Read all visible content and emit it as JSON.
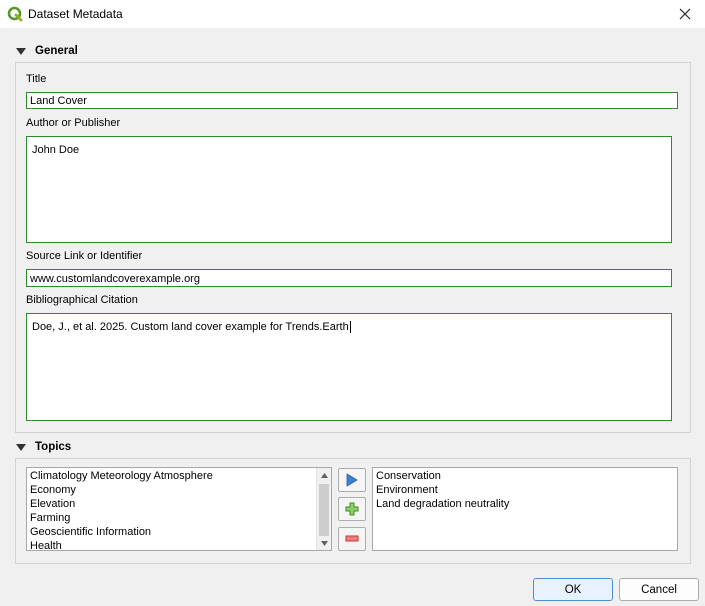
{
  "window": {
    "title": "Dataset Metadata",
    "icons": {
      "app": "qgis-logo-icon",
      "close": "close-icon"
    }
  },
  "general": {
    "header": "General",
    "title_label": "Title",
    "title_value": "Land Cover",
    "author_label": "Author or Publisher",
    "author_value": "John Doe",
    "source_label": "Source Link or Identifier",
    "source_value": "www.customlandcoverexample.org",
    "citation_label": "Bibliographical Citation",
    "citation_value": "Doe, J., et al. 2025. Custom land cover example for Trends.Earth"
  },
  "topics": {
    "header": "Topics",
    "available": [
      "Climatology Meteorology Atmosphere",
      "Economy",
      "Elevation",
      "Farming",
      "Geoscientific Information",
      "Health"
    ],
    "selected": [
      "Conservation",
      "Environment",
      "Land degradation neutrality"
    ],
    "buttons": {
      "move": "play-arrow-icon",
      "add": "plus-icon",
      "remove": "minus-icon"
    }
  },
  "dialog": {
    "ok_label": "OK",
    "cancel_label": "Cancel"
  },
  "colors": {
    "field_border": "#2e8b2e",
    "accent": "#4a90d9"
  }
}
